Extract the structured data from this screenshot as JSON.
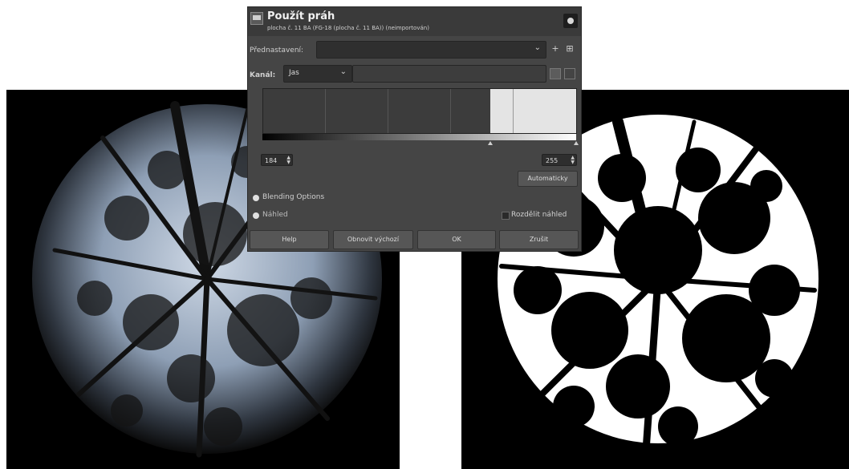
{
  "dialog": {
    "title": "Použít práh",
    "subtitle": "plocha č. 11 BA (FG-18 (plocha č. 11 BA)) (neimportován)",
    "presets_label": "Přednastavení:",
    "presets_value": "",
    "preset_add": "+",
    "preset_menu": "⊞",
    "channel_label": "Kanál:",
    "channel_value": "Jas",
    "low_value": "184",
    "high_value": "255",
    "auto_label": "Automaticky",
    "blending_label": "Blending Options",
    "preview_label": "Náhled",
    "split_label": "Rozdělit náhled",
    "help_label": "Help",
    "reset_label": "Obnovit výchozí",
    "ok_label": "OK",
    "cancel_label": "Zrušit"
  },
  "icons": {
    "dropdown": "chevron-down-icon",
    "spin": "spin-arrows-icon",
    "close": "close-icon",
    "app": "gimp-app-icon"
  },
  "colors": {
    "dialog_bg": "#454545",
    "titlebar_bg": "#3a3a3a",
    "field_bg": "#2f2f2f",
    "button_bg": "#565656",
    "histogram_threshold": "#e4e4e4"
  }
}
